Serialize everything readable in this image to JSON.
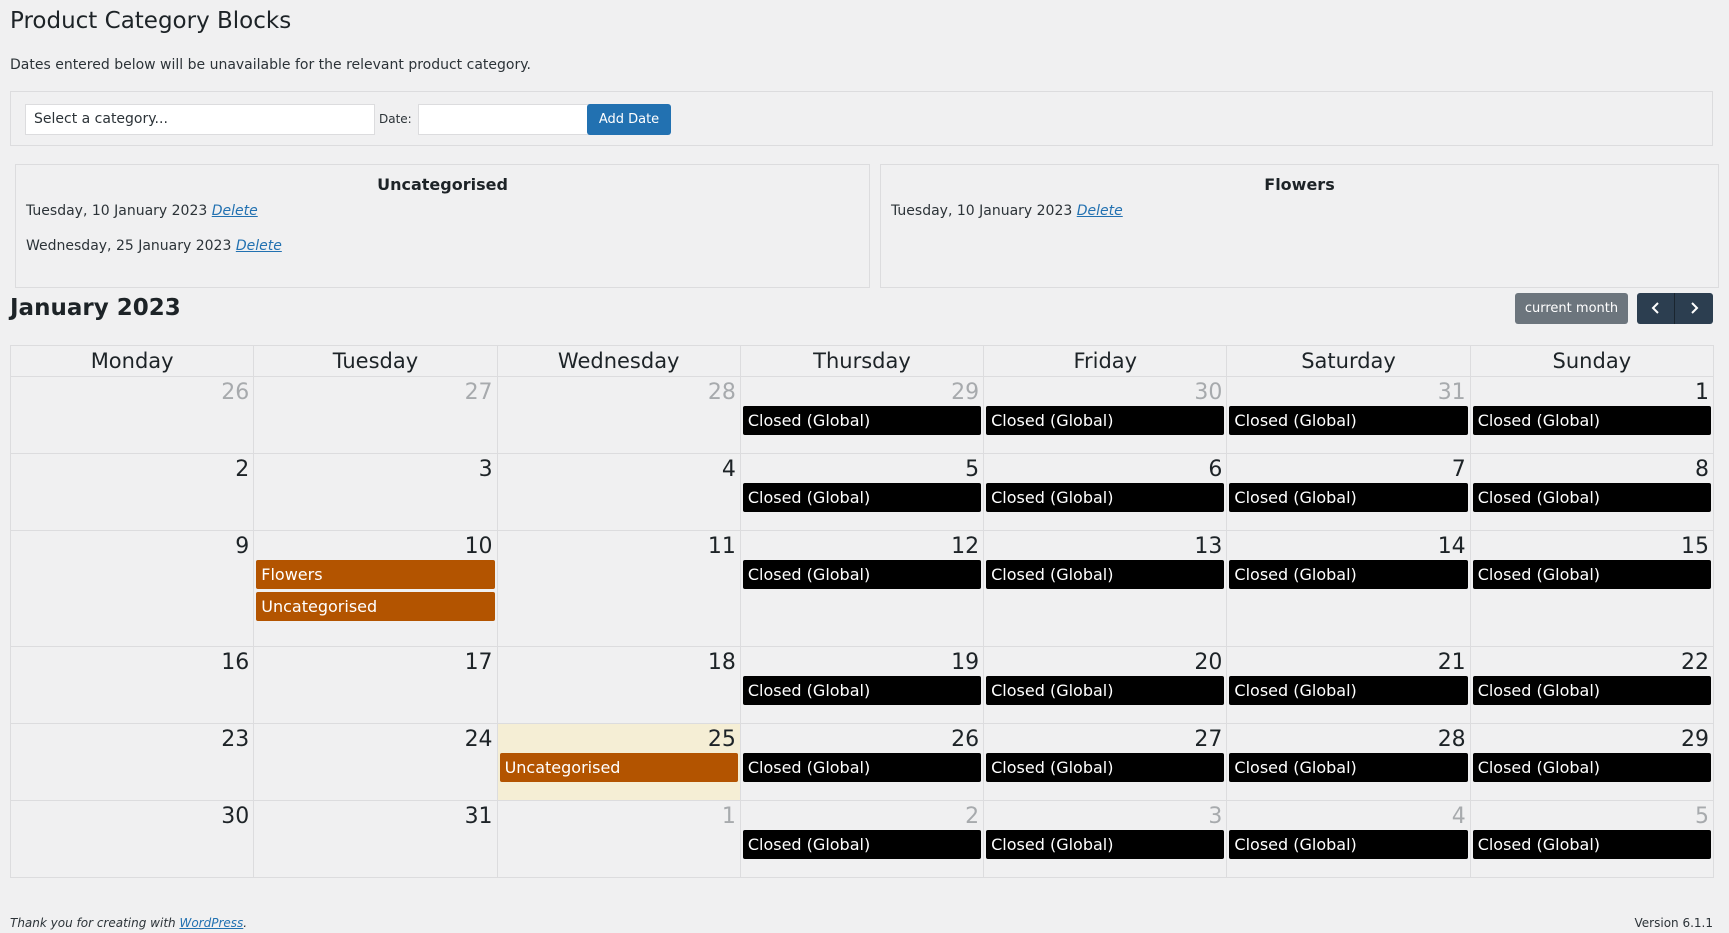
{
  "page": {
    "title": "Product Category Blocks",
    "description": "Dates entered below will be unavailable for the relevant product category."
  },
  "form": {
    "category_select": "Select a category...",
    "date_label": "Date:",
    "date_value": "",
    "add_button": "Add Date"
  },
  "categories": [
    {
      "name": "Uncategorised",
      "dates": [
        {
          "date": "Tuesday, 10 January 2023",
          "action": "Delete"
        },
        {
          "date": "Wednesday, 25 January 2023",
          "action": "Delete"
        }
      ]
    },
    {
      "name": "Flowers",
      "dates": [
        {
          "date": "Tuesday, 10 January 2023",
          "action": "Delete"
        }
      ]
    }
  ],
  "calendar": {
    "title": "January 2023",
    "current_month_button": "current month",
    "prev_icon": "chevron-left-icon",
    "next_icon": "chevron-right-icon",
    "weekdays": [
      "Monday",
      "Tuesday",
      "Wednesday",
      "Thursday",
      "Friday",
      "Saturday",
      "Sunday"
    ],
    "event_colors": {
      "closed": "#000000",
      "category": "#b35400",
      "today_bg": "#f5eed5"
    },
    "weeks": [
      [
        {
          "day": "26",
          "other": true,
          "events": []
        },
        {
          "day": "27",
          "other": true,
          "events": []
        },
        {
          "day": "28",
          "other": true,
          "events": []
        },
        {
          "day": "29",
          "other": true,
          "events": [
            {
              "label": "Closed (Global)",
              "kind": "closed"
            }
          ]
        },
        {
          "day": "30",
          "other": true,
          "events": [
            {
              "label": "Closed (Global)",
              "kind": "closed"
            }
          ]
        },
        {
          "day": "31",
          "other": true,
          "events": [
            {
              "label": "Closed (Global)",
              "kind": "closed"
            }
          ]
        },
        {
          "day": "1",
          "other": false,
          "events": [
            {
              "label": "Closed (Global)",
              "kind": "closed"
            }
          ]
        }
      ],
      [
        {
          "day": "2",
          "other": false,
          "events": []
        },
        {
          "day": "3",
          "other": false,
          "events": []
        },
        {
          "day": "4",
          "other": false,
          "events": []
        },
        {
          "day": "5",
          "other": false,
          "events": [
            {
              "label": "Closed (Global)",
              "kind": "closed"
            }
          ]
        },
        {
          "day": "6",
          "other": false,
          "events": [
            {
              "label": "Closed (Global)",
              "kind": "closed"
            }
          ]
        },
        {
          "day": "7",
          "other": false,
          "events": [
            {
              "label": "Closed (Global)",
              "kind": "closed"
            }
          ]
        },
        {
          "day": "8",
          "other": false,
          "events": [
            {
              "label": "Closed (Global)",
              "kind": "closed"
            }
          ]
        }
      ],
      [
        {
          "day": "9",
          "other": false,
          "events": []
        },
        {
          "day": "10",
          "other": false,
          "events": [
            {
              "label": "Flowers",
              "kind": "cat"
            },
            {
              "label": "Uncategorised",
              "kind": "cat"
            }
          ]
        },
        {
          "day": "11",
          "other": false,
          "events": []
        },
        {
          "day": "12",
          "other": false,
          "events": [
            {
              "label": "Closed (Global)",
              "kind": "closed"
            }
          ]
        },
        {
          "day": "13",
          "other": false,
          "events": [
            {
              "label": "Closed (Global)",
              "kind": "closed"
            }
          ]
        },
        {
          "day": "14",
          "other": false,
          "events": [
            {
              "label": "Closed (Global)",
              "kind": "closed"
            }
          ]
        },
        {
          "day": "15",
          "other": false,
          "events": [
            {
              "label": "Closed (Global)",
              "kind": "closed"
            }
          ]
        }
      ],
      [
        {
          "day": "16",
          "other": false,
          "events": []
        },
        {
          "day": "17",
          "other": false,
          "events": []
        },
        {
          "day": "18",
          "other": false,
          "events": []
        },
        {
          "day": "19",
          "other": false,
          "events": [
            {
              "label": "Closed (Global)",
              "kind": "closed"
            }
          ]
        },
        {
          "day": "20",
          "other": false,
          "events": [
            {
              "label": "Closed (Global)",
              "kind": "closed"
            }
          ]
        },
        {
          "day": "21",
          "other": false,
          "events": [
            {
              "label": "Closed (Global)",
              "kind": "closed"
            }
          ]
        },
        {
          "day": "22",
          "other": false,
          "events": [
            {
              "label": "Closed (Global)",
              "kind": "closed"
            }
          ]
        }
      ],
      [
        {
          "day": "23",
          "other": false,
          "events": []
        },
        {
          "day": "24",
          "other": false,
          "events": []
        },
        {
          "day": "25",
          "other": false,
          "today": true,
          "events": [
            {
              "label": "Uncategorised",
              "kind": "cat"
            }
          ]
        },
        {
          "day": "26",
          "other": false,
          "events": [
            {
              "label": "Closed (Global)",
              "kind": "closed"
            }
          ]
        },
        {
          "day": "27",
          "other": false,
          "events": [
            {
              "label": "Closed (Global)",
              "kind": "closed"
            }
          ]
        },
        {
          "day": "28",
          "other": false,
          "events": [
            {
              "label": "Closed (Global)",
              "kind": "closed"
            }
          ]
        },
        {
          "day": "29",
          "other": false,
          "events": [
            {
              "label": "Closed (Global)",
              "kind": "closed"
            }
          ]
        }
      ],
      [
        {
          "day": "30",
          "other": false,
          "events": []
        },
        {
          "day": "31",
          "other": false,
          "events": []
        },
        {
          "day": "1",
          "other": true,
          "events": []
        },
        {
          "day": "2",
          "other": true,
          "events": [
            {
              "label": "Closed (Global)",
              "kind": "closed"
            }
          ]
        },
        {
          "day": "3",
          "other": true,
          "events": [
            {
              "label": "Closed (Global)",
              "kind": "closed"
            }
          ]
        },
        {
          "day": "4",
          "other": true,
          "events": [
            {
              "label": "Closed (Global)",
              "kind": "closed"
            }
          ]
        },
        {
          "day": "5",
          "other": true,
          "events": [
            {
              "label": "Closed (Global)",
              "kind": "closed"
            }
          ]
        }
      ]
    ]
  },
  "footer": {
    "thanks_prefix": "Thank you for creating with ",
    "thanks_link": "WordPress",
    "thanks_suffix": ".",
    "version": "Version 6.1.1"
  }
}
